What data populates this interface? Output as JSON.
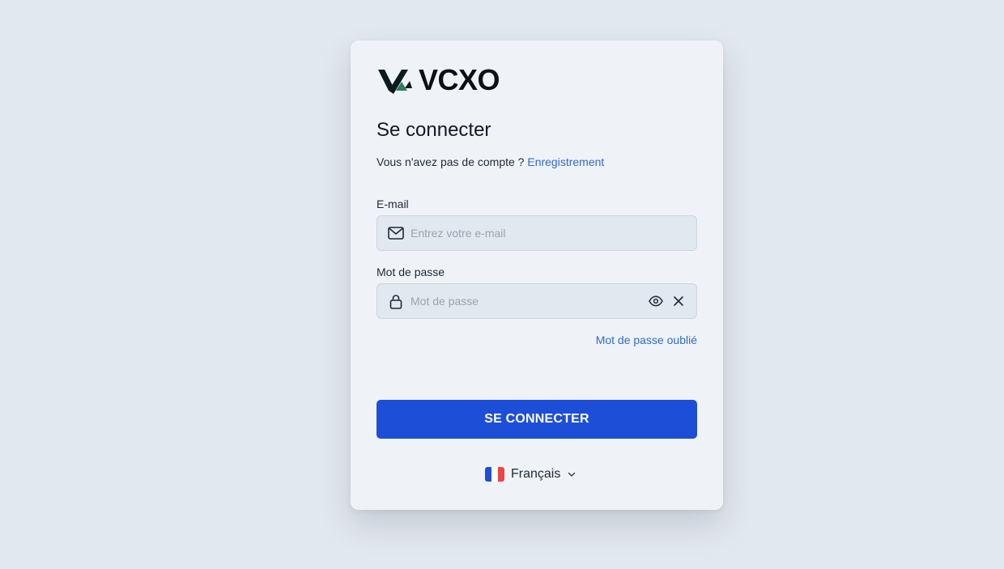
{
  "brand": {
    "name": "VCXO"
  },
  "login": {
    "title": "Se connecter",
    "no_account_text": "Vous n'avez pas de compte ?",
    "register_link": "Enregistrement",
    "email": {
      "label": "E-mail",
      "placeholder": "Entrez votre e-mail",
      "value": "",
      "icon": "mail-icon"
    },
    "password": {
      "label": "Mot de passe",
      "placeholder": "Mot de passe",
      "value": "",
      "icon": "lock-icon",
      "toggle_icon": "eye-icon",
      "clear_icon": "close-icon"
    },
    "forgot_link": "Mot de passe oublié",
    "submit_label": "SE CONNECTER"
  },
  "language": {
    "selected": "Français",
    "flag_colors": [
      "#1e4fd0",
      "#ffffff",
      "#ef4444"
    ],
    "icon": "chevron-down-icon"
  },
  "colors": {
    "accent": "#1d4ed8",
    "link": "#2f6ad0",
    "background": "#e2e8f0",
    "card": "#eff3f8"
  }
}
